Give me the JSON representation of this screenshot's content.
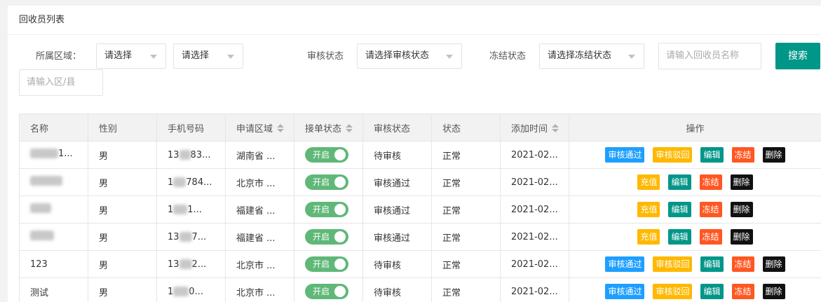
{
  "panel": {
    "title": "回收员列表"
  },
  "filters": {
    "region_label": "所属区域：",
    "region_select_1": "请选择",
    "region_select_2": "请选择",
    "audit_label": "审核状态",
    "audit_select": "请选择审核状态",
    "freeze_label": "冻结状态",
    "freeze_select": "请选择冻结状态",
    "name_placeholder": "请输入回收员名称",
    "search_button": "搜索",
    "district_placeholder": "请输入区/县"
  },
  "table": {
    "headers": {
      "name": "名称",
      "gender": "性别",
      "phone": "手机号码",
      "region": "申请区域",
      "order_status": "接单状态",
      "audit_status": "审核状态",
      "status": "状态",
      "added_time": "添加时间",
      "actions": "操作"
    },
    "rows": [
      {
        "name_suffix": "1...",
        "gender": "男",
        "phone_prefix": "13",
        "phone_suffix": "83...",
        "region": "湖南省 ...",
        "switch": "开启",
        "audit": "待审核",
        "status": "正常",
        "time": "2021-02...",
        "actions": [
          "审核通过",
          "审核驳回",
          "编辑",
          "冻结",
          "删除"
        ]
      },
      {
        "name_suffix": "",
        "gender": "男",
        "phone_prefix": "1",
        "phone_suffix": "784...",
        "region": "北京市 ...",
        "switch": "开启",
        "audit": "审核通过",
        "status": "正常",
        "time": "2021-02...",
        "actions": [
          "充值",
          "编辑",
          "冻结",
          "删除"
        ]
      },
      {
        "name_suffix": "",
        "gender": "男",
        "phone_prefix": "1",
        "phone_suffix": "1...",
        "region": "福建省 ...",
        "switch": "开启",
        "audit": "审核通过",
        "status": "正常",
        "time": "2021-02...",
        "actions": [
          "充值",
          "编辑",
          "冻结",
          "删除"
        ]
      },
      {
        "name_suffix": "",
        "gender": "男",
        "phone_prefix": "13",
        "phone_suffix": "7...",
        "region": "福建省 ...",
        "switch": "开启",
        "audit": "审核通过",
        "status": "正常",
        "time": "2021-02...",
        "actions": [
          "充值",
          "编辑",
          "冻结",
          "删除"
        ]
      },
      {
        "name": "123",
        "gender": "男",
        "phone_prefix": "13",
        "phone_suffix": "2...",
        "region": "北京市 ...",
        "switch": "开启",
        "audit": "待审核",
        "status": "正常",
        "time": "2021-02...",
        "actions": [
          "审核通过",
          "审核驳回",
          "编辑",
          "冻结",
          "删除"
        ]
      },
      {
        "name": "测试",
        "gender": "男",
        "phone_prefix": "1",
        "phone_suffix": "0...",
        "region": "北京市 ...",
        "switch": "开启",
        "audit": "待审核",
        "status": "正常",
        "time": "2021-02...",
        "actions": [
          "审核通过",
          "审核驳回",
          "编辑",
          "冻结",
          "删除"
        ]
      }
    ]
  },
  "colors": {
    "primary": "#009688",
    "switch_on": "#5fb878",
    "approve": "#1e9fff",
    "reject": "#ffb800",
    "recharge": "#ffb800",
    "edit": "#009688",
    "freeze": "#ff5722",
    "delete": "#111111"
  }
}
